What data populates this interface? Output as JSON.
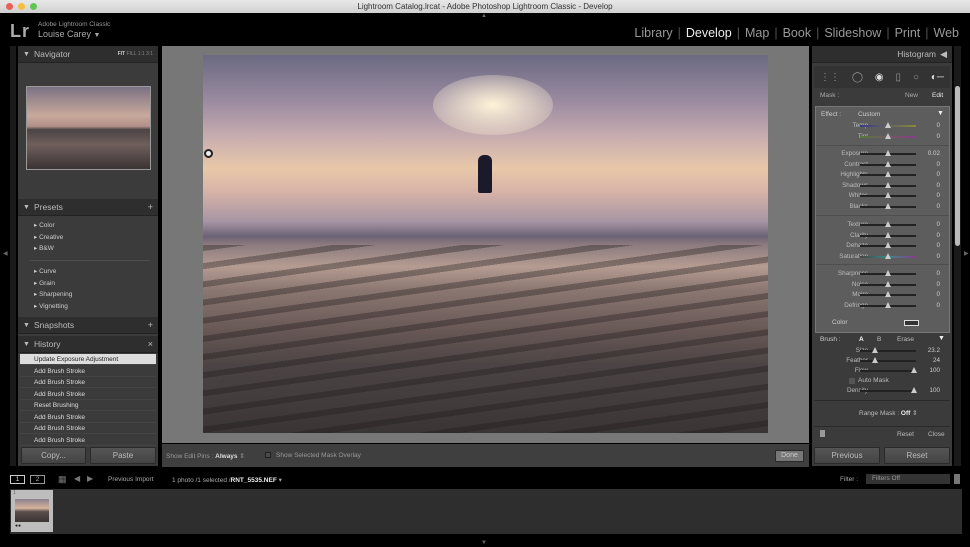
{
  "window": {
    "title": "Lightroom Catalog.lrcat - Adobe Photoshop Lightroom Classic - Develop"
  },
  "identity": {
    "app": "Adobe Lightroom Classic",
    "user": "Louise Carey",
    "logo": "Lr"
  },
  "modules": [
    {
      "label": "Library",
      "active": false
    },
    {
      "label": "Develop",
      "active": true
    },
    {
      "label": "Map",
      "active": false
    },
    {
      "label": "Book",
      "active": false
    },
    {
      "label": "Slideshow",
      "active": false
    },
    {
      "label": "Print",
      "active": false
    },
    {
      "label": "Web",
      "active": false
    }
  ],
  "navigator": {
    "title": "Navigator",
    "zoom": [
      "FIT",
      "FILL",
      "1:1",
      "3:1"
    ]
  },
  "presets": {
    "title": "Presets",
    "group1": [
      "Color",
      "Creative",
      "B&W"
    ],
    "group2": [
      "Curve",
      "Grain",
      "Sharpening",
      "Vignetting"
    ]
  },
  "snapshots": {
    "title": "Snapshots"
  },
  "history": {
    "title": "History",
    "items": [
      "Update Exposure Adjustment",
      "Add Brush Stroke",
      "Add Brush Stroke",
      "Add Brush Stroke",
      "Reset Brushing",
      "Add Brush Stroke",
      "Add Brush Stroke",
      "Add Brush Stroke"
    ]
  },
  "left_buttons": {
    "copy": "Copy...",
    "paste": "Paste"
  },
  "toolbar": {
    "pins_label": "Show Edit Pins :",
    "pins_value": "Always",
    "overlay_label": "Show Selected Mask Overlay",
    "done": "Done"
  },
  "right": {
    "histogram": "Histogram",
    "mask_label": "Mask :",
    "mask_new": "New",
    "mask_edit": "Edit",
    "effect_label": "Effect :",
    "effect_value": "Custom",
    "sliders": [
      {
        "label": "Temp",
        "value": "0",
        "pos": 0.5,
        "group": 0
      },
      {
        "label": "Tint",
        "value": "0",
        "pos": 0.5,
        "group": 0
      },
      {
        "label": "Exposure",
        "value": "0.02",
        "pos": 0.5,
        "group": 1
      },
      {
        "label": "Contrast",
        "value": "0",
        "pos": 0.5,
        "group": 1
      },
      {
        "label": "Highlights",
        "value": "0",
        "pos": 0.5,
        "group": 1
      },
      {
        "label": "Shadows",
        "value": "0",
        "pos": 0.5,
        "group": 1
      },
      {
        "label": "Whites",
        "value": "0",
        "pos": 0.5,
        "group": 1
      },
      {
        "label": "Blacks",
        "value": "0",
        "pos": 0.5,
        "group": 1
      },
      {
        "label": "Texture",
        "value": "0",
        "pos": 0.5,
        "group": 2
      },
      {
        "label": "Clarity",
        "value": "0",
        "pos": 0.5,
        "group": 2
      },
      {
        "label": "Dehaze",
        "value": "0",
        "pos": 0.5,
        "group": 2
      },
      {
        "label": "Saturation",
        "value": "0",
        "pos": 0.5,
        "group": 2
      },
      {
        "label": "Sharpness",
        "value": "0",
        "pos": 0.5,
        "group": 3
      },
      {
        "label": "Noise",
        "value": "0",
        "pos": 0.5,
        "group": 3
      },
      {
        "label": "Moire",
        "value": "0",
        "pos": 0.5,
        "group": 3
      },
      {
        "label": "Defringe",
        "value": "0",
        "pos": 0.5,
        "group": 3
      }
    ],
    "color_label": "Color",
    "brush_label": "Brush :",
    "brush_a": "A",
    "brush_b": "B",
    "brush_erase": "Erase",
    "brush_sliders": [
      {
        "label": "Size",
        "value": "23.2",
        "pos": 0.27
      },
      {
        "label": "Feather",
        "value": "24",
        "pos": 0.27
      },
      {
        "label": "Flow",
        "value": "100",
        "pos": 0.97
      },
      {
        "label": "Density",
        "value": "100",
        "pos": 0.97
      }
    ],
    "auto_mask": "Auto Mask",
    "range_mask_label": "Range Mask :",
    "range_mask_value": "Off",
    "reset": "Reset",
    "close": "Close",
    "previous": "Previous",
    "reset_button": "Reset"
  },
  "filmstrip": {
    "screen1": "1",
    "screen2": "2",
    "source": "Previous Import",
    "count": "1 photo /1 selected /",
    "filename": "RNT_5535.NEF",
    "filter_label": "Filter :",
    "filter_value": "Filters Off",
    "thumb_index": "1"
  }
}
